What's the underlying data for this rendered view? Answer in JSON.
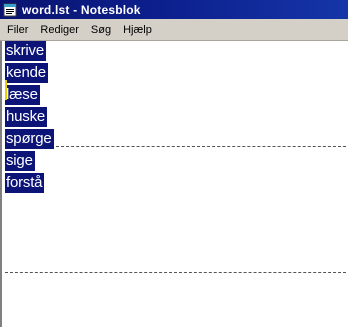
{
  "window": {
    "title": "word.lst - Notesblok"
  },
  "menu": {
    "items": [
      "Filer",
      "Rediger",
      "Søg",
      "Hjælp"
    ]
  },
  "editor": {
    "lines": [
      "skrive",
      "kende",
      "læse",
      "huske",
      "spørge",
      "sige",
      "forstå"
    ],
    "selection_color": "#0c1478"
  },
  "colors": {
    "titlebar": "#0c1f8c",
    "menubar": "#d4d0c8"
  },
  "icons": {
    "app": "notepad-icon"
  }
}
